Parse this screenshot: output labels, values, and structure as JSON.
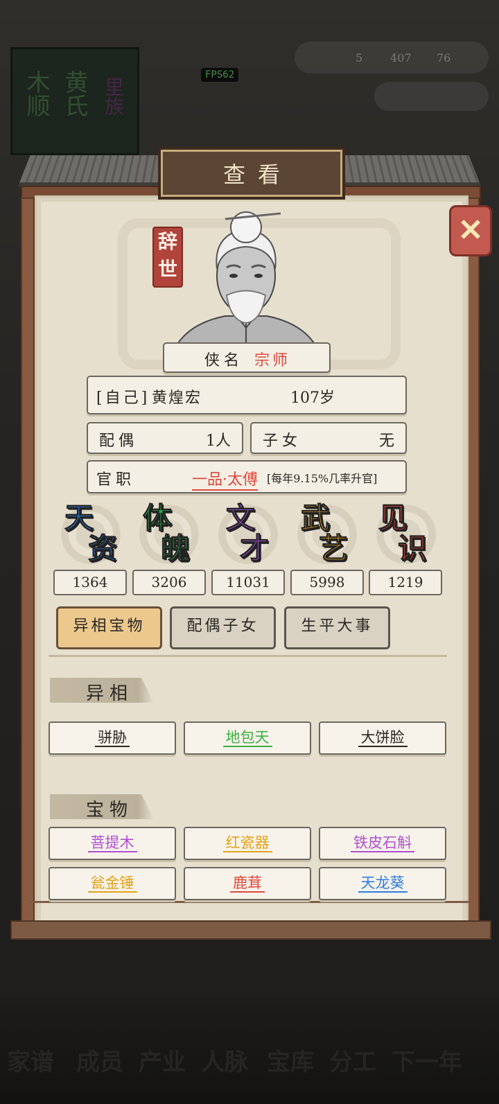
{
  "hud": {
    "fps": "FPS62",
    "res_a": "5",
    "res_b": "407",
    "res_c": "76"
  },
  "background": {
    "book_chars": [
      "木顺",
      "黄氏",
      "里族"
    ]
  },
  "modal": {
    "title": "查看",
    "status_seal": "辞世",
    "hero_name_label": "侠名",
    "hero_name_value": "宗师",
    "self_tag": "[自己]",
    "person_name": "黄煌宏",
    "age": "107岁",
    "spouse_label": "配偶",
    "spouse_value": "1人",
    "children_label": "子女",
    "children_value": "无",
    "office_label": "官职",
    "office_value": "一品·太傅",
    "promotion_text": "[每年9.15%几率升官]",
    "stats": [
      {
        "label1": "天",
        "label2": "资",
        "value": "1364",
        "color": "#2f7ce0"
      },
      {
        "label1": "体",
        "label2": "魄",
        "value": "3206",
        "color": "#2fae4c"
      },
      {
        "label1": "文",
        "label2": "才",
        "value": "11031",
        "color": "#a04fd0"
      },
      {
        "label1": "武",
        "label2": "艺",
        "value": "5998",
        "color": "#e5a21a"
      },
      {
        "label1": "见",
        "label2": "识",
        "value": "1219",
        "color": "#e0473d"
      }
    ],
    "tabs": [
      "异相宝物",
      "配偶子女",
      "生平大事"
    ],
    "section_traits": "异相",
    "traits": [
      {
        "name": "骈胁",
        "color": "#2a2724"
      },
      {
        "name": "地包天",
        "color": "#3cb043"
      },
      {
        "name": "大饼脸",
        "color": "#2a2724"
      }
    ],
    "section_treasures": "宝物",
    "treasures": [
      {
        "name": "菩提木",
        "color": "#b04fd0"
      },
      {
        "name": "红瓷器",
        "color": "#e5a21a"
      },
      {
        "name": "铁皮石斛",
        "color": "#b04fd0"
      },
      {
        "name": "瓮金锤",
        "color": "#e5a21a"
      },
      {
        "name": "鹿茸",
        "color": "#e0473d"
      },
      {
        "name": "天龙葵",
        "color": "#2f7ce0"
      }
    ]
  },
  "bottom_nav": [
    "家谱",
    "成员",
    "产业",
    "人脉",
    "宝库",
    "分工",
    "下一年"
  ]
}
